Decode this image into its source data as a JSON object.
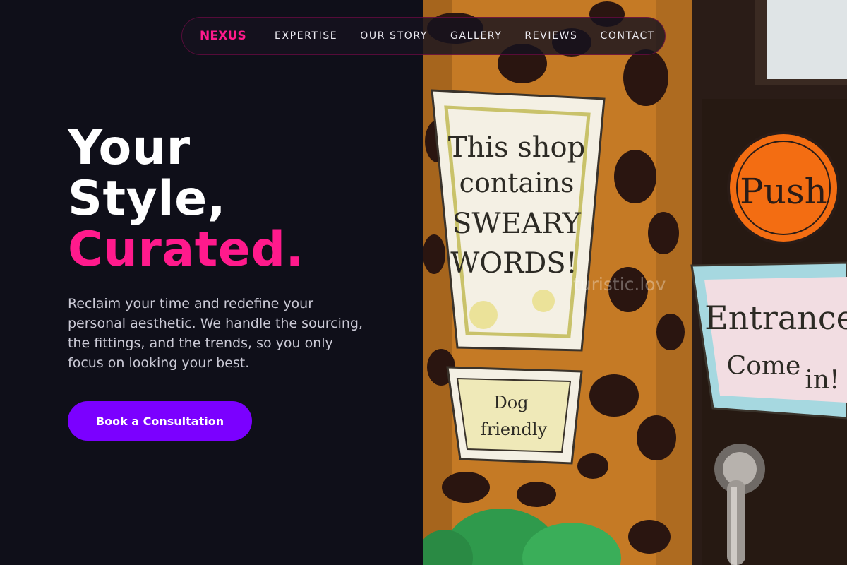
{
  "nav": {
    "brand": "NEXUS",
    "links": [
      "EXPERTISE",
      "OUR STORY",
      "GALLERY",
      "REVIEWS",
      "CONTACT"
    ]
  },
  "hero": {
    "title_line1": "Your",
    "title_line2": "Style,",
    "title_accent": "Curated.",
    "description": "Reclaim your time and redefine your personal aesthetic. We handle the sourcing, the fittings, and the trends, so you only focus on looking your best.",
    "cta_label": "Book a Consultation"
  },
  "photo": {
    "sign_main": [
      "This shop",
      "contains",
      "SWEARY",
      "WORDS!"
    ],
    "sign_small": [
      "Dog",
      "friendly"
    ],
    "sign_push": "Push",
    "sign_entrance": [
      "Entrance",
      "Come",
      "in!"
    ],
    "watermark": "turistic.lov"
  },
  "colors": {
    "background": "#0f0f19",
    "brand_pink": "#ff1a8c",
    "cta_purple": "#7b00ff",
    "body_text": "#cbcad6"
  }
}
